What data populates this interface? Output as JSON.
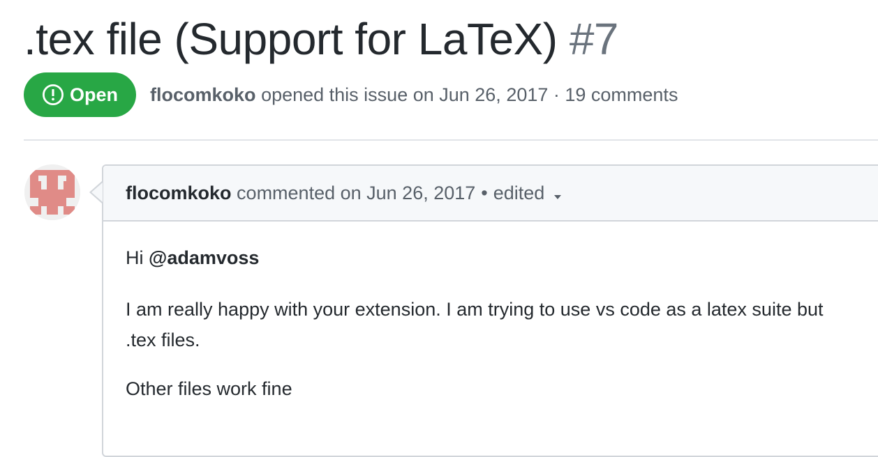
{
  "issue": {
    "title": ".tex file (Support for LaTeX)",
    "number": "#7",
    "state": "Open",
    "author": "flocomkoko",
    "opened_text": "opened this issue on Jun 26, 2017 · 19 comments"
  },
  "comment": {
    "author": "flocomkoko",
    "action": "commented on Jun 26, 2017",
    "bullet": "•",
    "edited": "edited",
    "greeting": "Hi",
    "mention": "@adamvoss",
    "line1": "I am really happy with your extension. I am trying to use vs code as a latex suite but",
    "line2": ".tex files.",
    "line3": "Other files work fine"
  },
  "colors": {
    "open_badge": "#28a745",
    "avatar_pattern": "#e08b87"
  },
  "icons": {
    "state": "issue-opened-icon",
    "edit_menu": "chevron-down-icon"
  }
}
